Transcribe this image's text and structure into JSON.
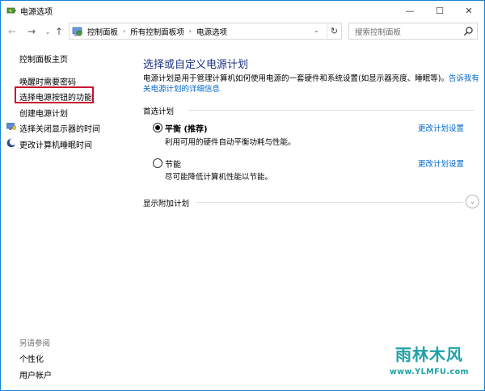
{
  "window": {
    "title": "电源选项",
    "controls": {
      "minimize": "—",
      "maximize": "☐",
      "close": "✕"
    }
  },
  "nav": {
    "back": "←",
    "forward": "→",
    "dropdown": "⌄",
    "up": "↑",
    "breadcrumbs": [
      "控制面板",
      "所有控制面板项",
      "电源选项"
    ],
    "separator": "›",
    "address_dropdown": "⌄",
    "refresh": "↻",
    "search_placeholder": "搜索控制面板"
  },
  "sidebar": {
    "home": "控制面板主页",
    "items": [
      {
        "label": "唤醒时需要密码",
        "icon": null
      },
      {
        "label": "选择电源按钮的功能",
        "icon": null,
        "highlighted": true
      },
      {
        "label": "创建电源计划",
        "icon": null
      },
      {
        "label": "选择关闭显示器的时间",
        "icon": "monitor-shield-icon"
      },
      {
        "label": "更改计算机睡眠时间",
        "icon": "moon-icon"
      }
    ],
    "see_also_label": "另请参阅",
    "see_also": [
      "个性化",
      "用户帐户"
    ]
  },
  "main": {
    "title": "选择或自定义电源计划",
    "description": "电源计划是用于管理计算机如何使用电源的一套硬件和系统设置(如显示器亮度、睡眠等)。",
    "description_link": "告诉我有关电源计划的详细信息",
    "preferred_label": "首选计划",
    "plans": [
      {
        "name": "平衡 (推荐)",
        "desc": "利用可用的硬件自动平衡功耗与性能。",
        "selected": true,
        "change": "更改计划设置"
      },
      {
        "name": "节能",
        "desc": "尽可能降低计算机性能以节能。",
        "selected": false,
        "change": "更改计划设置"
      }
    ],
    "more_plans_label": "显示附加计划",
    "more_plans_icon": "⌄"
  },
  "watermark": {
    "brand": "雨林木风",
    "url": "www.YLMFU.com"
  },
  "colors": {
    "title_blue": "#1e3287",
    "link_blue": "#0066cc",
    "highlight_red": "#c8102e",
    "window_border": "#1883d7",
    "watermark_teal": "#1da1a6"
  }
}
